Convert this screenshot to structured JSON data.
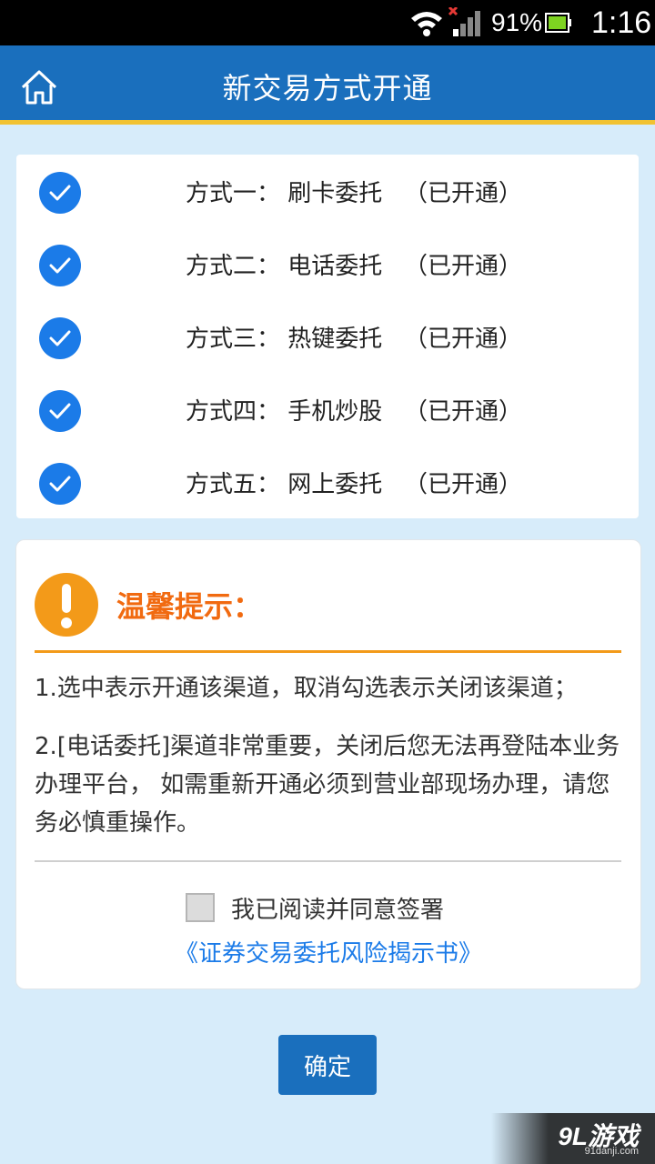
{
  "status_bar": {
    "battery": "91%",
    "time": "1:16"
  },
  "header": {
    "title": "新交易方式开通"
  },
  "methods": [
    {
      "label": "方式一： 刷卡委托",
      "status": "（已开通）",
      "checked": true
    },
    {
      "label": "方式二： 电话委托",
      "status": "（已开通）",
      "checked": true
    },
    {
      "label": "方式三： 热键委托",
      "status": "（已开通）",
      "checked": true
    },
    {
      "label": "方式四： 手机炒股",
      "status": "（已开通）",
      "checked": true
    },
    {
      "label": "方式五： 网上委托",
      "status": "（已开通）",
      "checked": true
    }
  ],
  "notice": {
    "title": "温馨提示：",
    "tip1": "1.选中表示开通该渠道，取消勾选表示关闭该渠道；",
    "tip2": "2.[电话委托]渠道非常重要，关闭后您无法再登陆本业务办理平台， 如需重新开通必须到营业部现场办理，请您务必慎重操作。",
    "agree_label": "我已阅读并同意签署",
    "agree_checked": false,
    "agreement_link": "《证券交易委托风险揭示书》"
  },
  "confirm_label": "确定",
  "watermark": {
    "logo": "9L游戏",
    "sub": "91danji.com"
  },
  "colors": {
    "header": "#1a6fbd",
    "header_accent": "#f1c232",
    "check": "#1b7be8",
    "warning": "#f39a19",
    "notice_title": "#f16a10",
    "link": "#1b7be8"
  }
}
